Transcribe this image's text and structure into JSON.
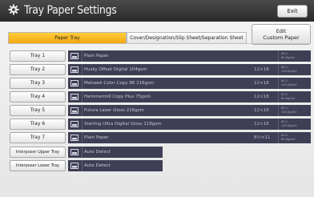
{
  "header": {
    "title": "Tray Paper Settings",
    "exit_label": "Exit"
  },
  "edit_custom_paper": {
    "line1": "Edit",
    "line2": "Custom Paper"
  },
  "tabs": [
    {
      "label": "Paper Tray",
      "active": true
    },
    {
      "label": "Cover/Designation/Slip Sheet/Separation Sheet",
      "active": false
    }
  ],
  "trays": [
    {
      "label": "Tray 1",
      "icon": "tray-icon",
      "paper": "Plain Paper",
      "size": "",
      "weight1": "63.1-",
      "weight2": "80.0g/m2"
    },
    {
      "label": "Tray 2",
      "icon": "tray-icon",
      "paper": "Husky Offset Digital 104gsm",
      "size": "12×18",
      "weight1": "80.1-",
      "weight2": "105.0g/m2"
    },
    {
      "label": "Tray 3",
      "icon": "tray-icon",
      "paper": "Mohawk Color Copy 98 216gsm",
      "size": "12×18",
      "weight1": "80.1-",
      "weight2": "105.0g/m2"
    },
    {
      "label": "Tray 4",
      "icon": "tray-icon",
      "paper": "Hammermill Copy Plus 75gsm",
      "size": "12×18",
      "weight1": "63.1-",
      "weight2": "80.0g/m2"
    },
    {
      "label": "Tray 5",
      "icon": "tray-icon",
      "paper": "Futura Laser Gloss  216gsm",
      "size": "12×18",
      "weight1": "80.1-",
      "weight2": "105.0g/m2"
    },
    {
      "label": "Tray 6",
      "icon": "tray-icon",
      "paper": "Sterling Ultra Digital Gloss 118gsm",
      "size": "12×18",
      "weight1": "80.1-",
      "weight2": "105.0g/m2"
    },
    {
      "label": "Tray 7",
      "icon": "tray-icon",
      "paper": "Plain Paper",
      "size": "8½×11",
      "weight1": "63.1-",
      "weight2": "80.0g/m2"
    }
  ],
  "interposers": [
    {
      "label": "Interposer Upper Tray",
      "icon": "tray-icon",
      "paper": "Auto Detect"
    },
    {
      "label": "Interposer Lower Tray",
      "icon": "tray-icon",
      "paper": "Auto Detect"
    }
  ]
}
